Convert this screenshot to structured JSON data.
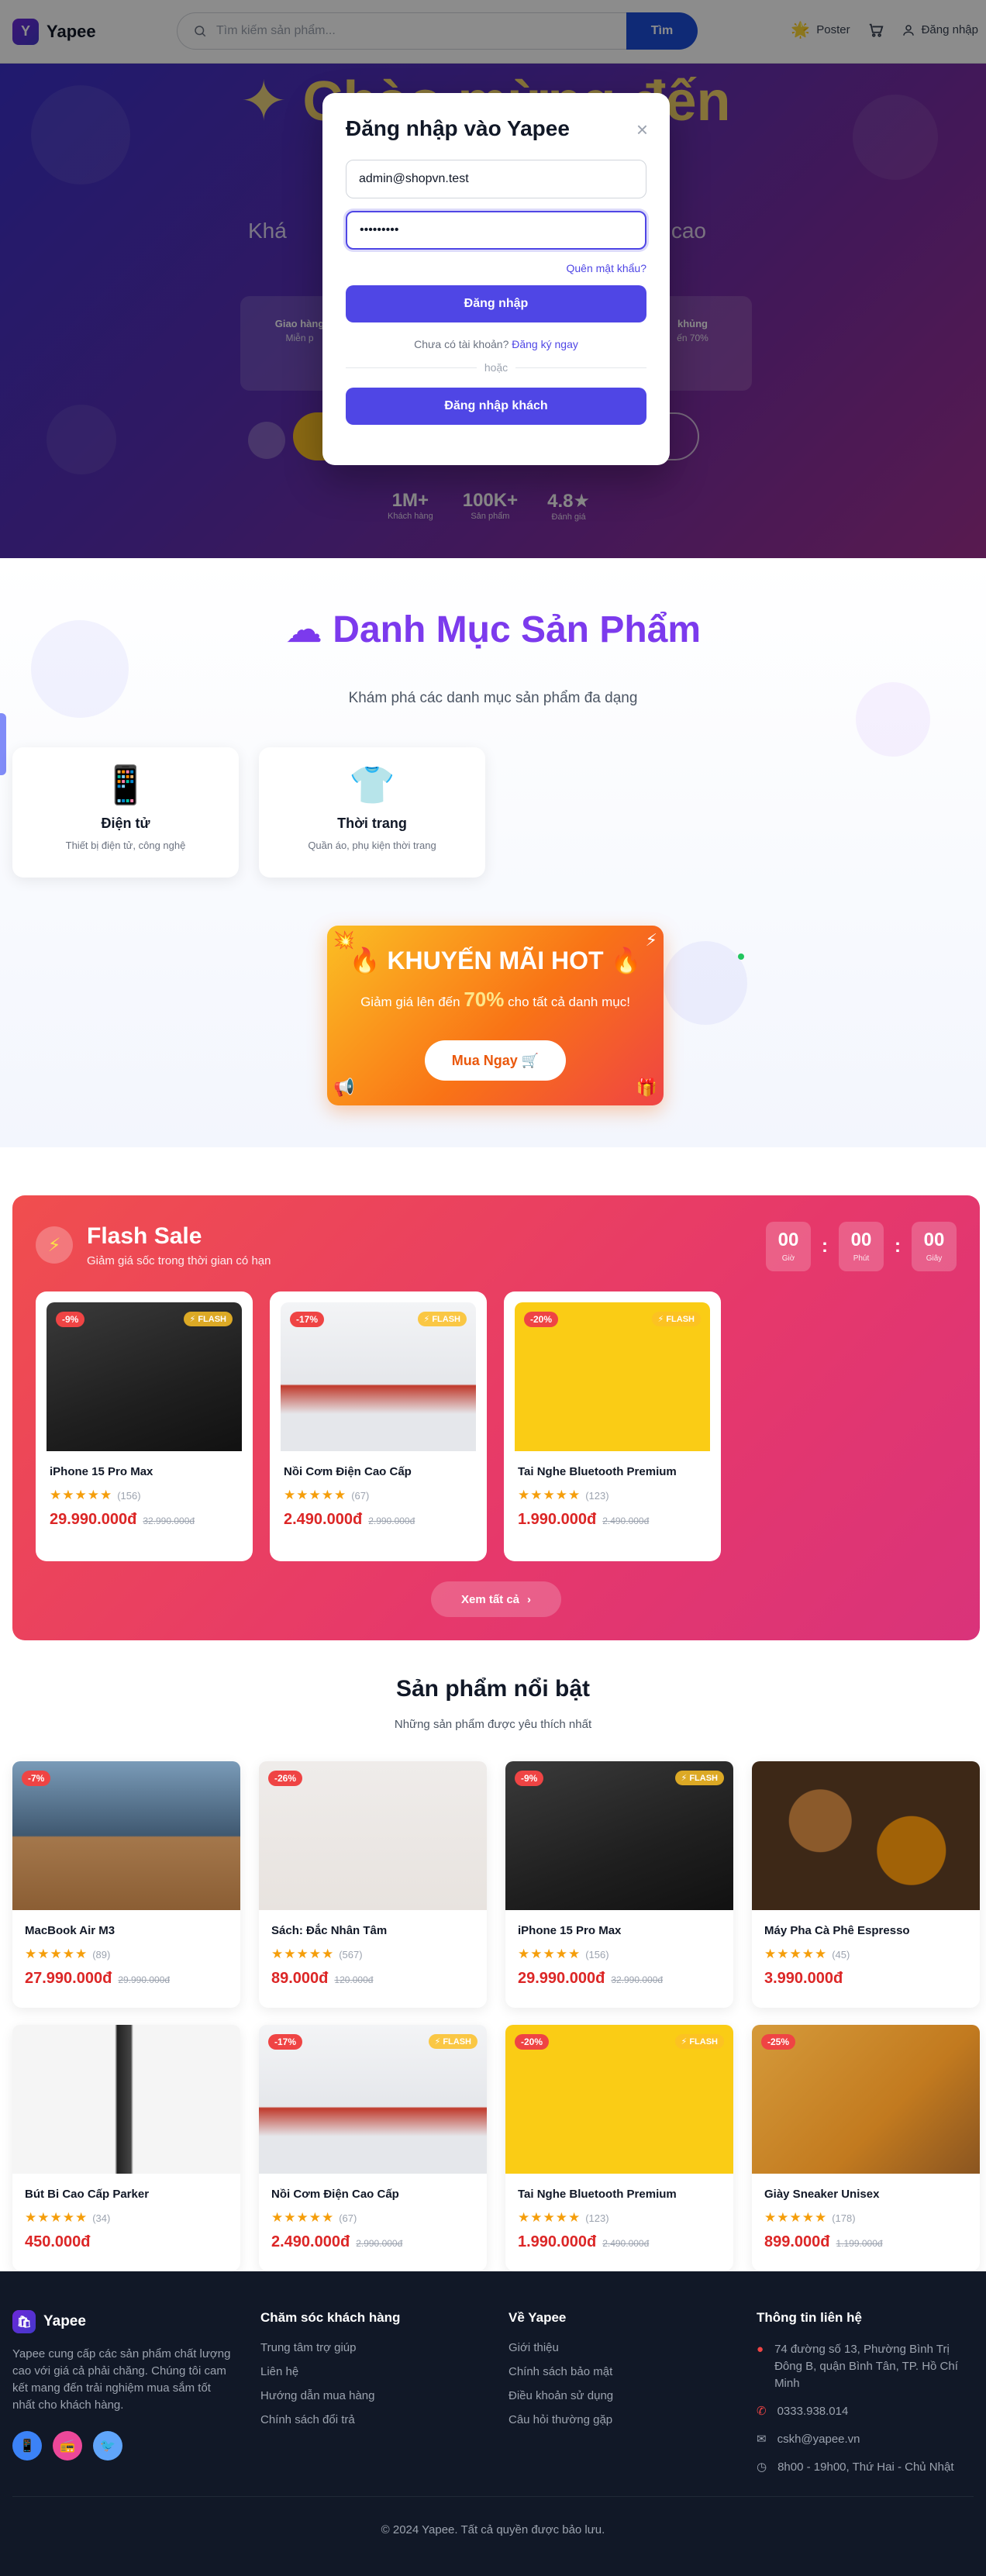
{
  "header": {
    "logo_letter": "Y",
    "brand": "Yapee",
    "search_placeholder": "Tìm kiếm sản phẩm...",
    "search_button": "Tìm",
    "poster": "Poster",
    "login": "Đăng nhập"
  },
  "hero": {
    "title": "Chào mừng đến",
    "subtitle_left": "Khá",
    "subtitle_right": "ượng cao",
    "features": [
      {
        "title": "Giao hàng",
        "desc": "Miễn p"
      },
      {
        "title": "",
        "desc": ""
      },
      {
        "title": "",
        "desc": ""
      },
      {
        "title": "khủng",
        "desc": "ến 70%"
      }
    ],
    "stats": [
      {
        "value": "1M+",
        "label": "Khách hàng"
      },
      {
        "value": "100K+",
        "label": "Sản phẩm"
      },
      {
        "value": "4.8★",
        "label": "Đánh giá"
      }
    ]
  },
  "login_modal": {
    "title": "Đăng nhập vào Yapee",
    "email": "admin@shopvn.test",
    "password": "•••••••••",
    "forgot": "Quên mật khẩu?",
    "login_button": "Đăng nhập",
    "no_account": "Chưa có tài khoản?",
    "signup": "Đăng ký ngay",
    "or": "hoặc",
    "guest_button": "Đăng nhập khách"
  },
  "categories": {
    "title": "Danh Mục Sản Phẩm",
    "subtitle": "Khám phá các danh mục sản phẩm đa dạng",
    "items": [
      {
        "icon": "📱",
        "name": "Điện tử",
        "desc": "Thiết bị điện tử, công nghệ"
      },
      {
        "icon": "👕",
        "name": "Thời trang",
        "desc": "Quần áo, phụ kiện thời trang"
      }
    ]
  },
  "promo": {
    "title": "🔥 KHUYẾN MÃI HOT 🔥",
    "sub_before": "Giảm giá lên đến",
    "sub_value": "70%",
    "sub_after": "cho tất cả danh mục!",
    "button": "Mua Ngay 🛒"
  },
  "flash_sale": {
    "title": "Flash Sale",
    "subtitle": "Giảm giá sốc trong thời gian có hạn",
    "timer": [
      {
        "value": "00",
        "label": "Giờ"
      },
      {
        "value": "00",
        "label": "Phút"
      },
      {
        "value": "00",
        "label": "Giây"
      }
    ],
    "flash_label": "⚡ FLASH",
    "products": [
      {
        "name": "iPhone 15 Pro Max",
        "discount": "-9%",
        "reviews": "(156)",
        "price": "29.990.000đ",
        "old_price": "32.990.000đ",
        "img": "phone"
      },
      {
        "name": "Nồi Cơm Điện Cao Cấp",
        "discount": "-17%",
        "reviews": "(67)",
        "price": "2.490.000đ",
        "old_price": "2.990.000đ",
        "img": "cook"
      },
      {
        "name": "Tai Nghe Bluetooth Premium",
        "discount": "-20%",
        "reviews": "(123)",
        "price": "1.990.000đ",
        "old_price": "2.490.000đ",
        "img": "head"
      }
    ],
    "see_all": "Xem tất cả"
  },
  "featured": {
    "title": "Sản phẩm nổi bật",
    "subtitle": "Những sản phẩm được yêu thích nhất",
    "products": [
      {
        "name": "MacBook Air M3",
        "discount": "-7%",
        "flash": false,
        "reviews": "(89)",
        "price": "27.990.000đ",
        "old_price": "29.990.000đ",
        "img": "mac"
      },
      {
        "name": "Sách: Đắc Nhân Tâm",
        "discount": "-26%",
        "flash": false,
        "reviews": "(567)",
        "price": "89.000đ",
        "old_price": "120.000đ",
        "img": "book"
      },
      {
        "name": "iPhone 15 Pro Max",
        "discount": "-9%",
        "flash": true,
        "reviews": "(156)",
        "price": "29.990.000đ",
        "old_price": "32.990.000đ",
        "img": "phone"
      },
      {
        "name": "Máy Pha Cà Phê Espresso",
        "discount": "",
        "flash": false,
        "reviews": "(45)",
        "price": "3.990.000đ",
        "old_price": "",
        "img": "coffee"
      },
      {
        "name": "Bút Bi Cao Cấp Parker",
        "discount": "",
        "flash": false,
        "reviews": "(34)",
        "price": "450.000đ",
        "old_price": "",
        "img": "pen"
      },
      {
        "name": "Nồi Cơm Điện Cao Cấp",
        "discount": "-17%",
        "flash": true,
        "reviews": "(67)",
        "price": "2.490.000đ",
        "old_price": "2.990.000đ",
        "img": "cook"
      },
      {
        "name": "Tai Nghe Bluetooth Premium",
        "discount": "-20%",
        "flash": true,
        "reviews": "(123)",
        "price": "1.990.000đ",
        "old_price": "2.490.000đ",
        "img": "head"
      },
      {
        "name": "Giày Sneaker Unisex",
        "discount": "-25%",
        "flash": false,
        "reviews": "(178)",
        "price": "899.000đ",
        "old_price": "1.199.000đ",
        "img": "shoe"
      }
    ]
  },
  "footer": {
    "brand": "Yapee",
    "about": "Yapee cung cấp các sản phẩm chất lượng cao với giá cả phải chăng. Chúng tôi cam kết mang đến trải nghiệm mua sắm tốt nhất cho khách hàng.",
    "col_care": {
      "title": "Chăm sóc khách hàng",
      "links": [
        "Trung tâm trợ giúp",
        "Liên hệ",
        "Hướng dẫn mua hàng",
        "Chính sách đổi trả"
      ]
    },
    "col_about": {
      "title": "Về Yapee",
      "links": [
        "Giới thiệu",
        "Chính sách bảo mật",
        "Điều khoản sử dụng",
        "Câu hỏi thường gặp"
      ]
    },
    "col_contact": {
      "title": "Thông tin liên hệ",
      "address": "74 đường số 13, Phường Bình Trị Đông B, quận Bình Tân, TP. Hồ Chí Minh",
      "phone": "0333.938.014",
      "email": "cskh@yapee.vn",
      "hours": "8h00 - 19h00, Thứ Hai - Chủ Nhật"
    },
    "copyright": "© 2024 Yapee. Tất cả quyền được bảo lưu."
  }
}
